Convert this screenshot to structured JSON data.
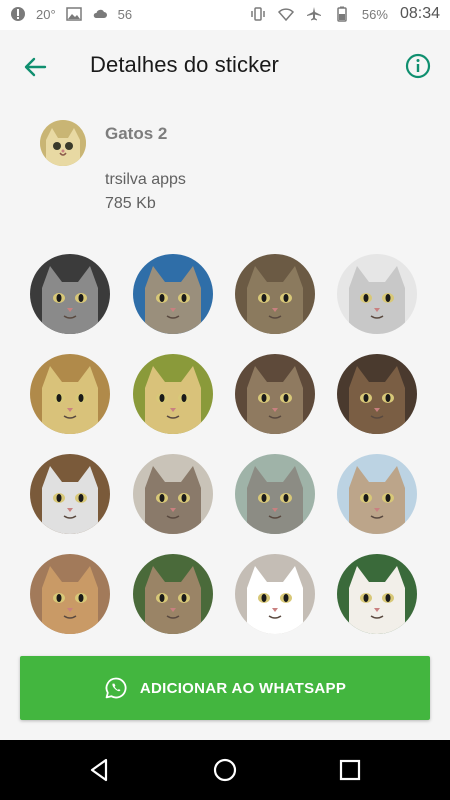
{
  "status_bar": {
    "temperature": "20°",
    "signal_number": "56",
    "battery": "56%",
    "time": "08:34"
  },
  "app_bar": {
    "title": "Detalhes do sticker",
    "back_icon": "arrow-back-icon",
    "info_icon": "info-icon"
  },
  "pack": {
    "name": "Gatos 2",
    "publisher": "trsilva apps",
    "size": "785 Kb"
  },
  "stickers": [
    {
      "id": 1,
      "fur": "#8a8a8a",
      "bg": "#3b3b3b"
    },
    {
      "id": 2,
      "fur": "#9a8f7c",
      "bg": "#2f6ea8"
    },
    {
      "id": 3,
      "fur": "#8b7a5e",
      "bg": "#6b5a44"
    },
    {
      "id": 4,
      "fur": "#c8c8c8",
      "bg": "#e6e6e6"
    },
    {
      "id": 5,
      "fur": "#d9c27a",
      "bg": "#b08a4a"
    },
    {
      "id": 6,
      "fur": "#d9c27a",
      "bg": "#8a9a3a"
    },
    {
      "id": 7,
      "fur": "#8f7a60",
      "bg": "#5e4a3a"
    },
    {
      "id": 8,
      "fur": "#7a5e44",
      "bg": "#4a3a2e"
    },
    {
      "id": 9,
      "fur": "#e0e0e0",
      "bg": "#7a5a3a"
    },
    {
      "id": 10,
      "fur": "#8a7a6a",
      "bg": "#c9c3b8"
    },
    {
      "id": 11,
      "fur": "#8c8c84",
      "bg": "#9fb3a8"
    },
    {
      "id": 12,
      "fur": "#bca58a",
      "bg": "#bcd3e3"
    },
    {
      "id": 13,
      "fur": "#c99a66",
      "bg": "#a27a5a"
    },
    {
      "id": 14,
      "fur": "#9a8466",
      "bg": "#4a6a3a"
    },
    {
      "id": 15,
      "fur": "#ffffff",
      "bg": "#c4bdb5"
    },
    {
      "id": 16,
      "fur": "#f2efe9",
      "bg": "#3a6a3a"
    }
  ],
  "cta": {
    "label": "ADICIONAR AO WHATSAPP",
    "icon": "whatsapp-icon"
  },
  "colors": {
    "accent": "#0f8f6f",
    "cta_green": "#43b63f"
  },
  "nav": {
    "back": "nav-back-icon",
    "home": "nav-home-icon",
    "recents": "nav-recents-icon"
  }
}
